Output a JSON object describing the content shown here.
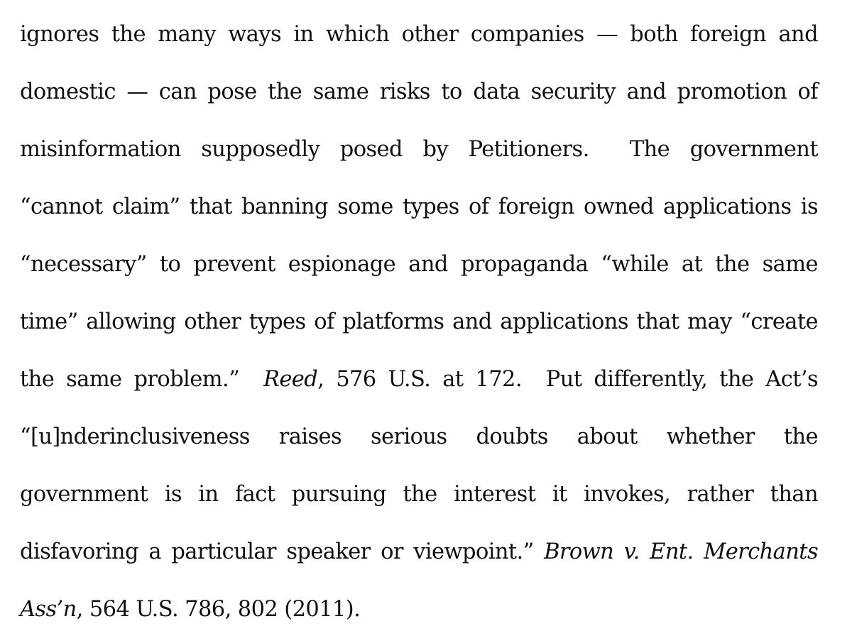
{
  "document": {
    "paragraph": {
      "lines": [
        {
          "segments": [
            "ignores the many ways in which other companies — both foreign and"
          ]
        },
        {
          "segments": [
            "domestic — can pose the same risks to data security and promotion of"
          ]
        },
        {
          "segments": [
            "misinformation supposedly posed by Petitioners.  The government"
          ]
        },
        {
          "segments": [
            "“cannot claim” that banning some types of foreign owned applications is"
          ]
        },
        {
          "segments": [
            "“necessary” to prevent espionage and propaganda “while at the same"
          ]
        },
        {
          "segments": [
            "time” allowing other types of platforms and applications that may “create"
          ]
        },
        {
          "segments": [
            "the same problem.”  ",
            "Reed",
            ", 576 U.S. at 172.  Put differently, the Act’s"
          ]
        },
        {
          "segments": [
            "“[u]nderinclusiveness raises serious doubts about whether the"
          ]
        },
        {
          "segments": [
            "government is in fact pursuing the interest it invokes, rather than"
          ]
        },
        {
          "segments": [
            "disfavoring a particular speaker or viewpoint.” ",
            "Brown v. Ent. Merchants"
          ]
        },
        {
          "segments": [
            "Ass’n",
            ", 564 U.S. 786, 802 (2011)."
          ]
        }
      ]
    },
    "citations": [
      {
        "case": "Reed",
        "reporter": "576 U.S. at 172"
      },
      {
        "case": "Brown v. Ent. Merchants Ass’n",
        "reporter": "564 U.S. 786, 802 (2011)"
      }
    ]
  }
}
